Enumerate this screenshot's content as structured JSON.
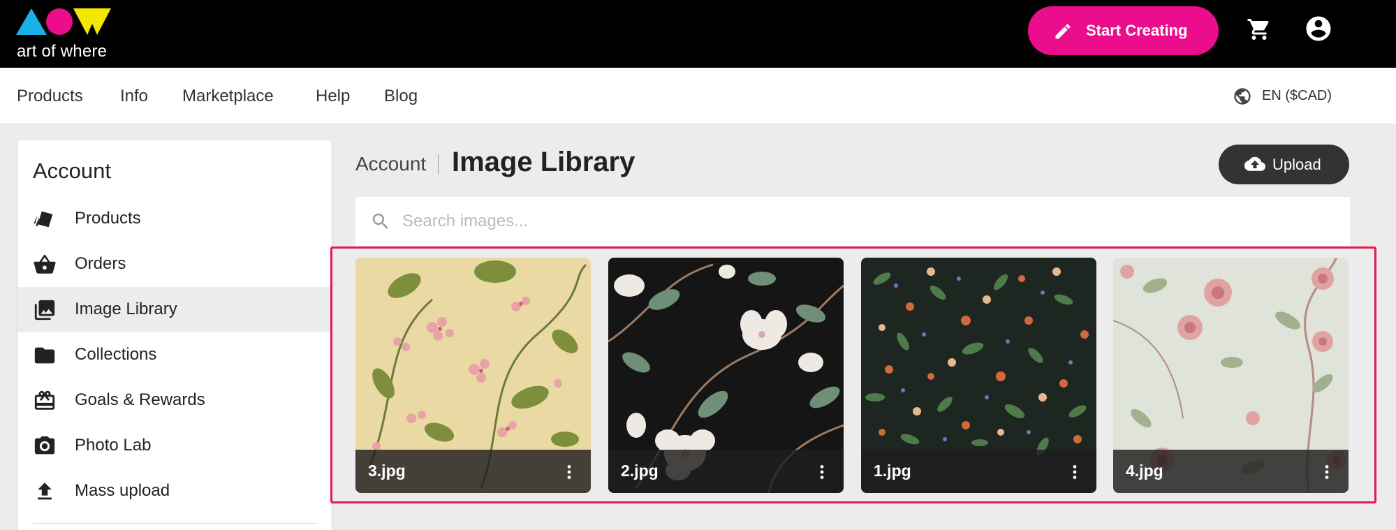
{
  "brand": {
    "name": "art of where",
    "colors": [
      "#1ab0e8",
      "#ec0d8c",
      "#f5e800"
    ]
  },
  "topbar": {
    "start_creating": "Start Creating",
    "start_color": "#ec0d8c",
    "cart_icon": "cart-icon",
    "account_icon": "account-circle-icon"
  },
  "nav": {
    "items": [
      "Products",
      "Info",
      "Marketplace",
      "Help",
      "Blog"
    ],
    "language": "EN ($CAD)"
  },
  "sidebar": {
    "title": "Account",
    "items": [
      {
        "label": "Products",
        "icon": "products-tags-icon"
      },
      {
        "label": "Orders",
        "icon": "basket-icon"
      },
      {
        "label": "Image Library",
        "icon": "image-library-icon",
        "active": true
      },
      {
        "label": "Collections",
        "icon": "folder-icon"
      },
      {
        "label": "Goals & Rewards",
        "icon": "gift-icon"
      },
      {
        "label": "Photo Lab",
        "icon": "camera-icon"
      },
      {
        "label": "Mass upload",
        "icon": "upload-arrow-icon"
      }
    ]
  },
  "header": {
    "breadcrumb": "Account",
    "title": "Image Library",
    "upload_label": "Upload"
  },
  "search": {
    "placeholder": "Search images..."
  },
  "gallery": {
    "highlight_color": "#e8174f",
    "images": [
      {
        "filename": "3.jpg",
        "pattern": "pink blossoms on cream"
      },
      {
        "filename": "2.jpg",
        "pattern": "white magnolias on black"
      },
      {
        "filename": "1.jpg",
        "pattern": "wildflowers on dark green"
      },
      {
        "filename": "4.jpg",
        "pattern": "pink roses on pale green"
      }
    ]
  }
}
